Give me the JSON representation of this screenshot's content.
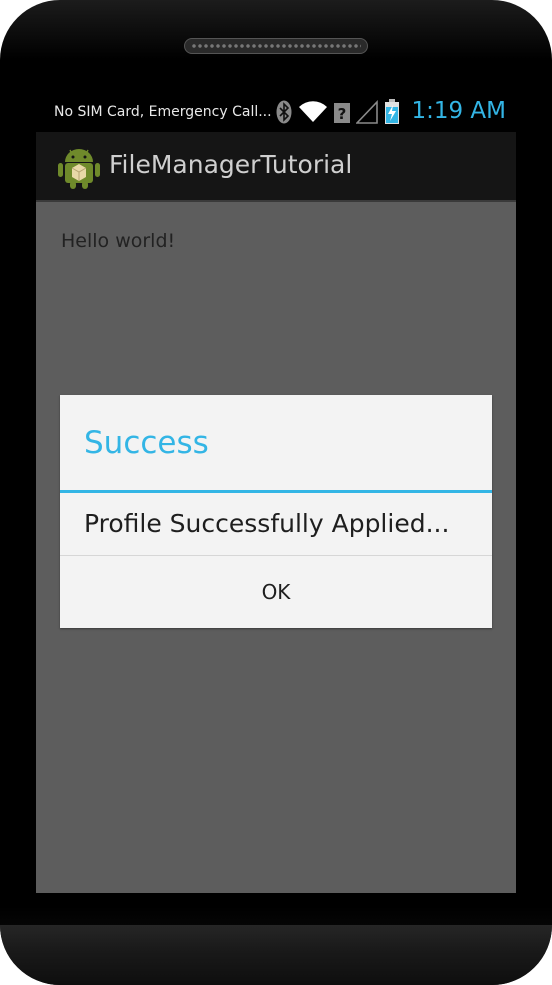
{
  "status_bar": {
    "carrier_text": "No SIM Card, Emergency Call...",
    "time": "1:19 AM",
    "icons": [
      "bluetooth-icon",
      "wifi-icon",
      "signal-icon",
      "battery-charging-icon"
    ]
  },
  "action_bar": {
    "app_icon": "android-icon",
    "title": "FileManagerTutorial"
  },
  "main": {
    "hello_text": "Hello world!"
  },
  "dialog": {
    "title": "Success",
    "message": "Profile Successfully Applied...",
    "ok_label": "OK"
  },
  "colors": {
    "accent": "#33b5e5",
    "content_bg": "#5d5d5d",
    "dialog_bg": "#f3f3f3",
    "actionbar_bg": "#151515"
  }
}
